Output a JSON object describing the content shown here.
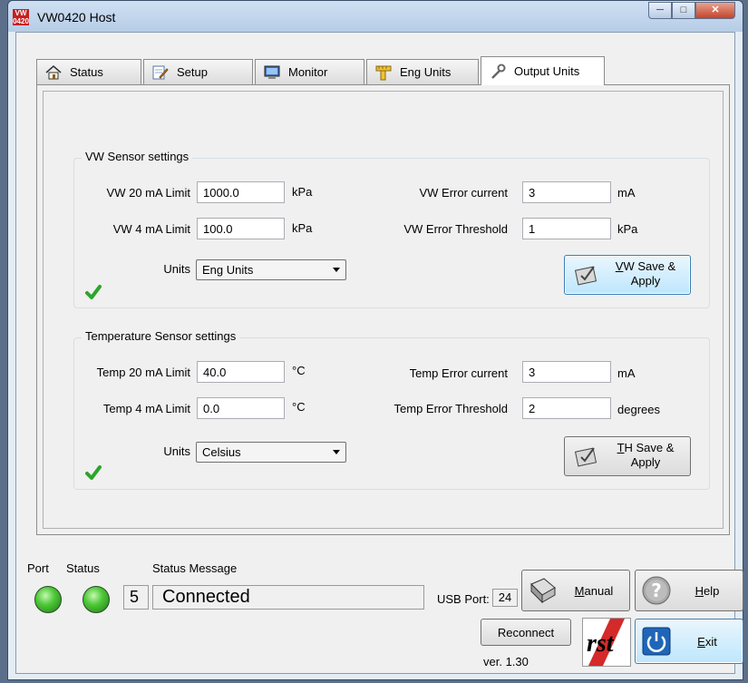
{
  "window": {
    "title": "VW0420 Host",
    "icon_text": "VW 0420",
    "controls": [
      "minimize",
      "maximize",
      "close"
    ]
  },
  "tabs": [
    {
      "label": "Status",
      "icon": "home-icon"
    },
    {
      "label": "Setup",
      "icon": "edit-icon"
    },
    {
      "label": "Monitor",
      "icon": "monitor-icon"
    },
    {
      "label": "Eng Units",
      "icon": "ruler-icon"
    },
    {
      "label": "Output Units",
      "icon": "wrench-icon",
      "active": true
    }
  ],
  "vw": {
    "title": "VW Sensor settings",
    "limit20_label": "VW 20 mA Limit",
    "limit20_value": "1000.0",
    "limit20_unit": "kPa",
    "limit4_label": "VW 4 mA Limit",
    "limit4_value": "100.0",
    "limit4_unit": "kPa",
    "error_current_label": "VW Error current",
    "error_current_value": "3",
    "error_current_unit": "mA",
    "error_threshold_label": "VW Error Threshold",
    "error_threshold_value": "1",
    "error_threshold_unit": "kPa",
    "units_label": "Units",
    "units_value": "Eng Units",
    "save_line1_key": "V",
    "save_line1_rest": "W Save &",
    "save_line2": "Apply"
  },
  "temp": {
    "title": "Temperature Sensor settings",
    "limit20_label": "Temp 20 mA Limit",
    "limit20_value": "40.0",
    "limit20_unit": "°C",
    "limit4_label": "Temp 4 mA Limit",
    "limit4_value": "0.0",
    "limit4_unit": "°C",
    "error_current_label": "Temp Error current",
    "error_current_value": "3",
    "error_current_unit": "mA",
    "error_threshold_label": "Temp Error Threshold",
    "error_threshold_value": "2",
    "error_threshold_unit": "degrees",
    "units_label": "Units",
    "units_value": "Celsius",
    "save_line1_key": "T",
    "save_line1_rest": "H Save &",
    "save_line2": "Apply"
  },
  "status_bar": {
    "port_label": "Port",
    "status_label": "Status",
    "message_label": "Status Message",
    "status_code": "5",
    "status_message": "Connected",
    "usb_label": "USB Port:",
    "usb_value": "24",
    "version": "ver.  1.30",
    "logo_text": "rst"
  },
  "buttons": {
    "manual_key": "M",
    "manual_rest": "anual",
    "help_key": "H",
    "help_rest": "elp",
    "reconnect": "Reconnect",
    "exit_key": "E",
    "exit_rest": "xit"
  },
  "colors": {
    "led_green": "#4fc93a",
    "check_green": "#2da52d",
    "accent": "#3c7fb1",
    "title_bar": "#c4d7ee"
  }
}
